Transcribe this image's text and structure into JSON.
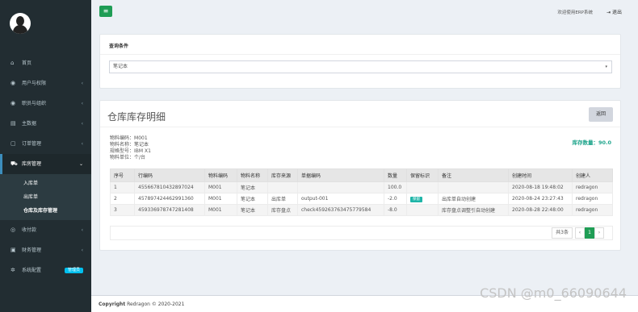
{
  "sidebar": {
    "menu": [
      {
        "icon": "home",
        "glyph": "⌂",
        "label": "首页",
        "chevron": ""
      },
      {
        "icon": "user",
        "glyph": "◉",
        "label": "用户与权限",
        "chevron": "‹"
      },
      {
        "icon": "org",
        "glyph": "◉",
        "label": "职员与组织",
        "chevron": "‹"
      },
      {
        "icon": "data",
        "glyph": "▤",
        "label": "主数据",
        "chevron": "‹"
      },
      {
        "icon": "order",
        "glyph": "▢",
        "label": "订单管理",
        "chevron": "‹"
      },
      {
        "icon": "warehouse",
        "glyph": "⛟",
        "label": "库房管理",
        "chevron": "⌄"
      }
    ],
    "submenu": [
      "入库单",
      "出库单",
      "仓库及库存管理"
    ],
    "menu2": [
      {
        "icon": "payment",
        "glyph": "◎",
        "label": "收付款",
        "chevron": "‹"
      },
      {
        "icon": "finance",
        "glyph": "▣",
        "label": "财务管理",
        "chevron": "‹"
      },
      {
        "icon": "settings",
        "glyph": "✲",
        "label": "系统配置",
        "badge": "管理员"
      }
    ]
  },
  "topbar": {
    "toggle_glyph": "≡",
    "welcome": "欢迎使用ERP系统",
    "logout": "⇥ 退出"
  },
  "query": {
    "title": "查询条件",
    "select_value": "笔记本",
    "caret": "▾"
  },
  "detail": {
    "title": "仓库库存明细",
    "back": "返回",
    "info": [
      {
        "label": "物料编码：",
        "value": "M001"
      },
      {
        "label": "物料名称：",
        "value": "笔记本"
      },
      {
        "label": "规格型号：",
        "value": "IBM X1"
      },
      {
        "label": "物料单位：",
        "value": "个/台"
      }
    ],
    "stock_label": "库存数量：",
    "stock_value": "90.0",
    "columns": [
      "序号",
      "行编码",
      "物料编码",
      "物料名称",
      "库存来源",
      "单据编码",
      "数量",
      "保留标识",
      "备注",
      "创建时间",
      "创建人"
    ],
    "rows": [
      [
        "1",
        "455667810432897024",
        "M001",
        "笔记本",
        "",
        "",
        "100.0",
        "",
        "",
        "2020-08-18 19:48:02",
        "redragon"
      ],
      [
        "2",
        "457897424462991360",
        "M001",
        "笔记本",
        "出库单",
        "output-001",
        "-2.0",
        "保留",
        "出库单自动创建",
        "2020-08-24 23:27:43",
        "redragon"
      ],
      [
        "3",
        "459336978747281408",
        "M001",
        "笔记本",
        "库存盘点",
        "check459263763475779584",
        "-8.0",
        "",
        "库存盘点调整引自动创建",
        "2020-08-28 22:48:00",
        "redragon"
      ]
    ],
    "pager": {
      "total": "共3条",
      "prev": "‹",
      "current": "1",
      "next": "›"
    }
  },
  "footer": {
    "copyright_bold": "Copyright",
    "copyright_rest": " Redragon © 2020-2021"
  },
  "watermark": "CSDN @m0_66090644"
}
